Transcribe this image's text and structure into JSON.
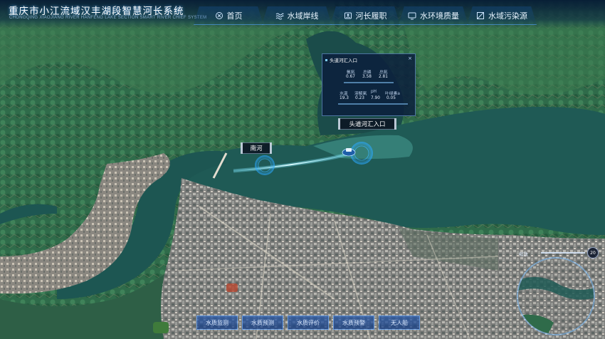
{
  "header": {
    "title": "重庆市小江流域汉丰湖段智慧河长系统",
    "subtitle": "CHONGQING XIAOJIANG RIVER HANFENG LAKE SECTION SMART RIVER CHIEF SYSTEM"
  },
  "nav": [
    {
      "label": "首页",
      "icon": "home-icon"
    },
    {
      "label": "水域岸线",
      "icon": "waves-icon"
    },
    {
      "label": "河长履职",
      "icon": "person-icon"
    },
    {
      "label": "水环境质量",
      "icon": "monitor-icon"
    },
    {
      "label": "水域污染源",
      "icon": "factory-icon"
    }
  ],
  "info_panel": {
    "title": "头道河汇入口",
    "close": "×",
    "metrics_row1": [
      {
        "label": "氨氮",
        "value": "0.67"
      },
      {
        "label": "总磷",
        "value": "3.58"
      },
      {
        "label": "总氮",
        "value": "2.81"
      }
    ],
    "metrics_row2": [
      {
        "label": "水温",
        "value": "19.3"
      },
      {
        "label": "溶解氧",
        "value": "0.23"
      },
      {
        "label": "pH",
        "value": "7.90"
      },
      {
        "label": "叶绿素a",
        "value": "0.05"
      }
    ]
  },
  "map_labels": {
    "outlet": "头道河汇入口",
    "river": "南河"
  },
  "toolbar": [
    "水质监测",
    "水质预测",
    "水质评价",
    "水质预警",
    "无人船"
  ],
  "zoom": {
    "label": "缩放",
    "level": "20"
  },
  "colors": {
    "water": "#1f5a55",
    "trajectory": "#7fe9ff",
    "accent": "#3a8bff"
  }
}
